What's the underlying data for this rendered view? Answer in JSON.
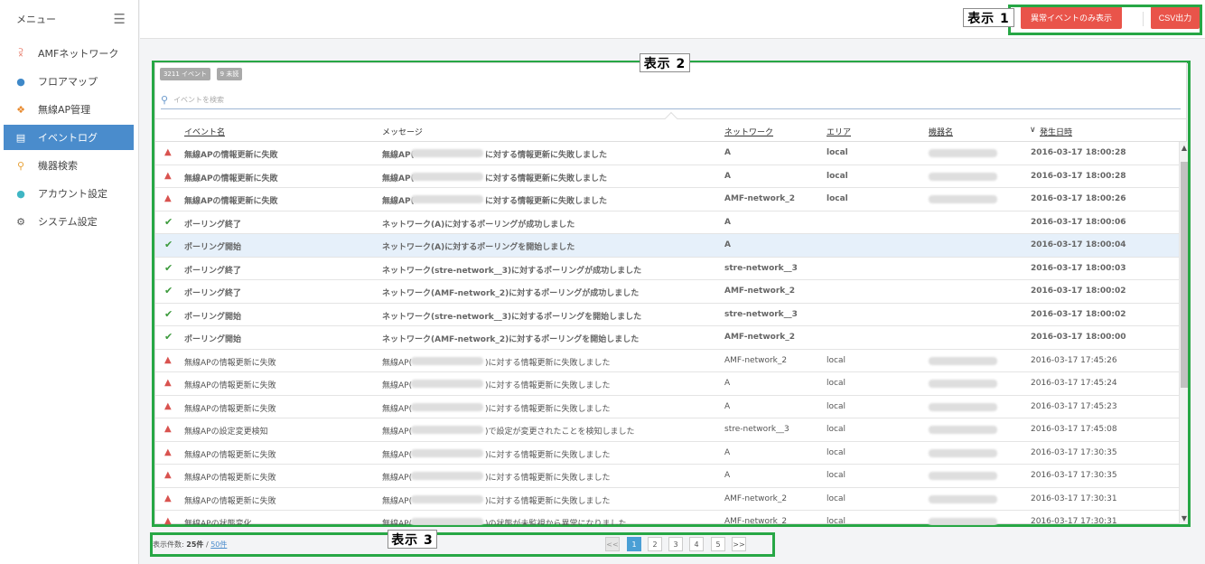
{
  "sidebar": {
    "title": "メニュー",
    "items": [
      {
        "label": "AMFネットワーク",
        "icon": "share-icon",
        "color": "#e0533c"
      },
      {
        "label": "フロアマップ",
        "icon": "map-pin-icon",
        "color": "#3e88c8"
      },
      {
        "label": "無線AP管理",
        "icon": "wifi-antenna-icon",
        "color": "#e88a2e"
      },
      {
        "label": "イベントログ",
        "icon": "document-icon",
        "active": true
      },
      {
        "label": "機器検索",
        "icon": "search-icon",
        "color": "#e8a33a"
      },
      {
        "label": "アカウント設定",
        "icon": "user-icon",
        "color": "#3fb6c4"
      },
      {
        "label": "システム設定",
        "icon": "gear-icon",
        "color": "#555555"
      }
    ]
  },
  "toolbar": {
    "abnormal_only_label": "異常イベントのみ表示",
    "csv_label": "CSV出力"
  },
  "callouts": {
    "c1": "表示 1",
    "c2": "表示 2",
    "c3": "表示 3"
  },
  "badges": {
    "events": "3211 イベント",
    "unread": "9 未読"
  },
  "search": {
    "placeholder": "イベントを検索"
  },
  "table": {
    "headers": {
      "event": "イベント名",
      "message": "メッセージ",
      "network": "ネットワーク",
      "area": "エリア",
      "device": "機器名",
      "sort_mark": "∨",
      "date": "発生日時"
    },
    "rows": [
      {
        "type": "warn",
        "bold": true,
        "event": "無線APの情報更新に失敗",
        "msg_pre": "無線AP(",
        "msg_post": "に対する情報更新に失敗しました",
        "network": "A",
        "area": "local",
        "date": "2016-03-17 18:00:28"
      },
      {
        "type": "warn",
        "bold": true,
        "event": "無線APの情報更新に失敗",
        "msg_pre": "無線AP(",
        "msg_post": "に対する情報更新に失敗しました",
        "network": "A",
        "area": "local",
        "date": "2016-03-17 18:00:28"
      },
      {
        "type": "warn",
        "bold": true,
        "event": "無線APの情報更新に失敗",
        "msg_pre": "無線AP(",
        "msg_post": "に対する情報更新に失敗しました",
        "network": "AMF-network_2",
        "area": "local",
        "date": "2016-03-17 18:00:26"
      },
      {
        "type": "ok",
        "bold": true,
        "event": "ポーリング終了",
        "msg_pre": "ネットワーク(A)に対するポーリングが成功しました",
        "msg_post": "",
        "network": "A",
        "area": "",
        "date": "2016-03-17 18:00:06"
      },
      {
        "type": "ok",
        "bold": true,
        "selected": true,
        "event": "ポーリング開始",
        "msg_pre": "ネットワーク(A)に対するポーリングを開始しました",
        "msg_post": "",
        "network": "A",
        "area": "",
        "date": "2016-03-17 18:00:04"
      },
      {
        "type": "ok",
        "bold": true,
        "event": "ポーリング終了",
        "msg_pre": "ネットワーク(stre-network__3)に対するポーリングが成功しました",
        "msg_post": "",
        "network": "stre-network__3",
        "area": "",
        "date": "2016-03-17 18:00:03"
      },
      {
        "type": "ok",
        "bold": true,
        "event": "ポーリング終了",
        "msg_pre": "ネットワーク(AMF-network_2)に対するポーリングが成功しました",
        "msg_post": "",
        "network": "AMF-network_2",
        "area": "",
        "date": "2016-03-17 18:00:02"
      },
      {
        "type": "ok",
        "bold": true,
        "event": "ポーリング開始",
        "msg_pre": "ネットワーク(stre-network__3)に対するポーリングを開始しました",
        "msg_post": "",
        "network": "stre-network__3",
        "area": "",
        "date": "2016-03-17 18:00:02"
      },
      {
        "type": "ok",
        "bold": true,
        "event": "ポーリング開始",
        "msg_pre": "ネットワーク(AMF-network_2)に対するポーリングを開始しました",
        "msg_post": "",
        "network": "AMF-network_2",
        "area": "",
        "date": "2016-03-17 18:00:00"
      },
      {
        "type": "warn",
        "bold": false,
        "event": "無線APの情報更新に失敗",
        "msg_pre": "無線AP(",
        "msg_post": ")に対する情報更新に失敗しました",
        "network": "AMF-network_2",
        "area": "local",
        "date": "2016-03-17 17:45:26"
      },
      {
        "type": "warn",
        "bold": false,
        "event": "無線APの情報更新に失敗",
        "msg_pre": "無線AP(",
        "msg_post": ")に対する情報更新に失敗しました",
        "network": "A",
        "area": "local",
        "date": "2016-03-17 17:45:24"
      },
      {
        "type": "warn",
        "bold": false,
        "event": "無線APの情報更新に失敗",
        "msg_pre": "無線AP(",
        "msg_post": ")に対する情報更新に失敗しました",
        "network": "A",
        "area": "local",
        "date": "2016-03-17 17:45:23"
      },
      {
        "type": "warn",
        "bold": false,
        "event": "無線APの設定変更検知",
        "msg_pre": "無線AP(",
        "msg_post": ")で設定が変更されたことを検知しました",
        "network": "stre-network__3",
        "area": "local",
        "date": "2016-03-17 17:45:08"
      },
      {
        "type": "warn",
        "bold": false,
        "event": "無線APの情報更新に失敗",
        "msg_pre": "無線AP(",
        "msg_post": ")に対する情報更新に失敗しました",
        "network": "A",
        "area": "local",
        "date": "2016-03-17 17:30:35"
      },
      {
        "type": "warn",
        "bold": false,
        "event": "無線APの情報更新に失敗",
        "msg_pre": "無線AP(",
        "msg_post": ")に対する情報更新に失敗しました",
        "network": "A",
        "area": "local",
        "date": "2016-03-17 17:30:35"
      },
      {
        "type": "warn",
        "bold": false,
        "event": "無線APの情報更新に失敗",
        "msg_pre": "無線AP(",
        "msg_post": ")に対する情報更新に失敗しました",
        "network": "AMF-network_2",
        "area": "local",
        "date": "2016-03-17 17:30:31"
      },
      {
        "type": "warn",
        "bold": false,
        "event": "無線APの状態変化",
        "msg_pre": "無線AP(",
        "msg_post": ")の状態が未監視から異常になりました",
        "network": "AMF-network_2",
        "area": "local",
        "date": "2016-03-17 17:30:31"
      }
    ]
  },
  "footer": {
    "count_label": "表示件数:",
    "count_current": "25件",
    "count_sep": "/",
    "count_link": "50件",
    "pages": [
      "<<",
      "1",
      "2",
      "3",
      "4",
      "5",
      ">>"
    ],
    "active_page": "1"
  }
}
